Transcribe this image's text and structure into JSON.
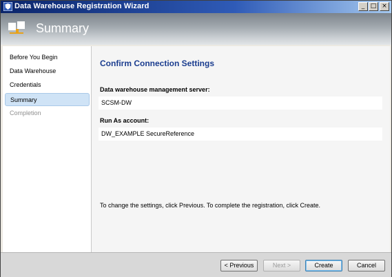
{
  "window": {
    "title": "Data Warehouse Registration Wizard",
    "controls": {
      "minimize": "_",
      "maximize": "□",
      "close": "×"
    }
  },
  "header": {
    "title": "Summary"
  },
  "sidebar": {
    "items": [
      {
        "label": "Before You Begin",
        "state": "normal"
      },
      {
        "label": "Data Warehouse",
        "state": "normal"
      },
      {
        "label": "Credentials",
        "state": "normal"
      },
      {
        "label": "Summary",
        "state": "selected"
      },
      {
        "label": "Completion",
        "state": "disabled"
      }
    ]
  },
  "main": {
    "heading": "Confirm Connection Settings",
    "server_label": "Data warehouse management server:",
    "server_value": "SCSM-DW",
    "account_label": "Run As account:",
    "account_value": "DW_EXAMPLE SecureReference",
    "hint": "To change the settings, click Previous. To complete the registration, click Create."
  },
  "footer": {
    "previous": "< Previous",
    "next": "Next >",
    "create": "Create",
    "cancel": "Cancel"
  },
  "colors": {
    "heading": "#1b3d8f",
    "selected_bg": "#cfe3f6",
    "titlebar": "#0a246a"
  },
  "icons": {
    "app": "shield-icon",
    "header": "wizard-panels-icon"
  }
}
